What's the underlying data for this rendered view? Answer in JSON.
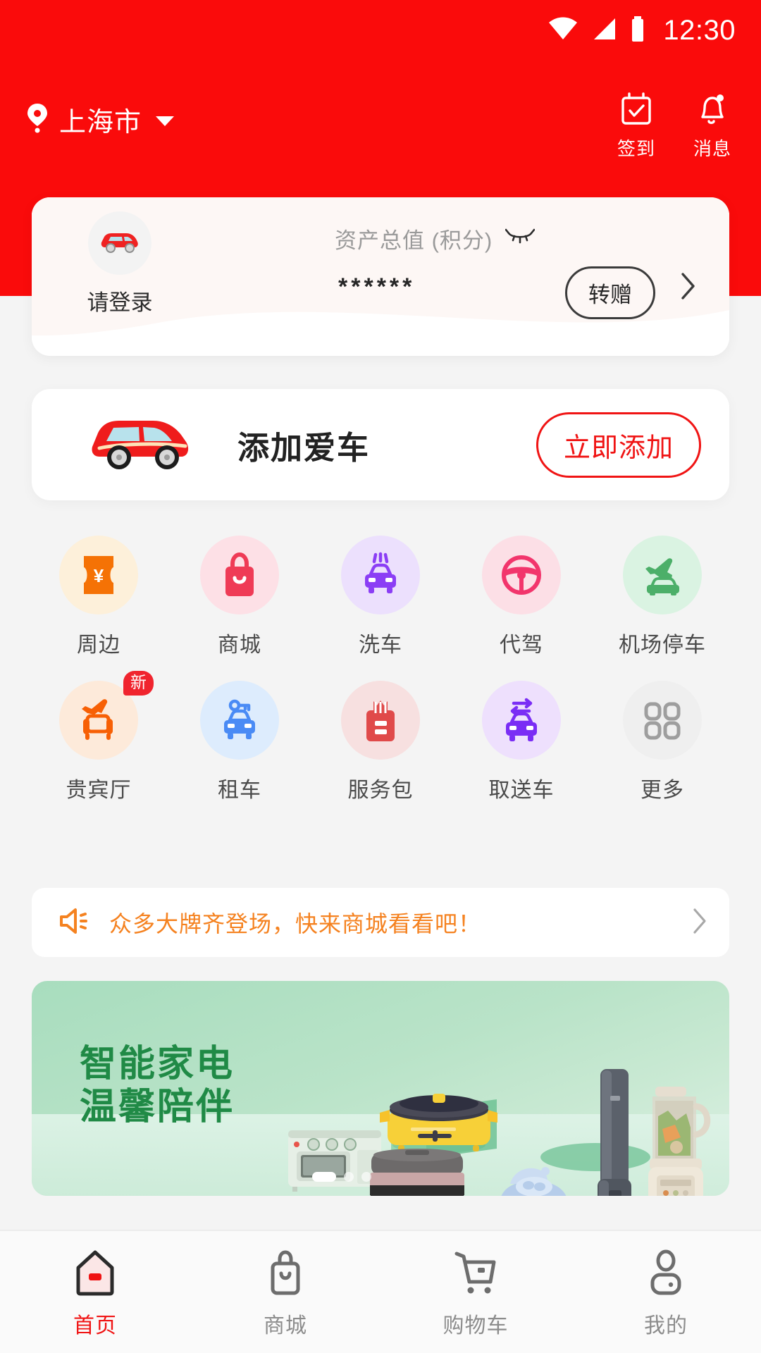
{
  "theme": {
    "brand_red": "#fa0b0b",
    "accent_orange": "#f58220",
    "banner_green": "#208a46",
    "muted_gray": "#9a9a9a"
  },
  "status_bar": {
    "time": "12:30",
    "icons": [
      "wifi-icon",
      "signal-icon",
      "battery-icon"
    ]
  },
  "header": {
    "location_icon": "location-pin-icon",
    "city": "上海市",
    "dropdown_icon": "chevron-down-icon",
    "actions": [
      {
        "icon": "checkin-calendar-icon",
        "label": "签到"
      },
      {
        "icon": "bell-icon",
        "label": "消息"
      }
    ]
  },
  "asset_card": {
    "avatar_icon": "car-avatar-icon",
    "login_label": "请登录",
    "title": "资产总值 (积分)",
    "eye_icon": "eye-closed-icon",
    "value": "******",
    "transfer_label": "转赠",
    "chevron_icon": "chevron-right-icon"
  },
  "car_card": {
    "car_icon": "red-car-icon",
    "title": "添加爱车",
    "button_label": "立即添加"
  },
  "grid": {
    "items": [
      {
        "label": "周边",
        "icon": "coupon-yuan-icon",
        "bg": "#fdf0da",
        "fg": "#f57205",
        "badge": null
      },
      {
        "label": "商城",
        "icon": "shopping-bag-icon",
        "bg": "#fde0e6",
        "fg": "#ef3b56",
        "badge": null
      },
      {
        "label": "洗车",
        "icon": "car-wash-icon",
        "bg": "#ece0fd",
        "fg": "#8b3ef5",
        "badge": null
      },
      {
        "label": "代驾",
        "icon": "steering-wheel-icon",
        "bg": "#fcdfe6",
        "fg": "#f2356c",
        "badge": null
      },
      {
        "label": "机场停车",
        "icon": "airport-parking-icon",
        "bg": "#daf3e2",
        "fg": "#4caf69",
        "badge": null
      },
      {
        "label": "贵宾厅",
        "icon": "vip-lounge-icon",
        "bg": "#fdeada",
        "fg": "#f76005",
        "badge": "新"
      },
      {
        "label": "租车",
        "icon": "car-rental-key-icon",
        "bg": "#ddecfd",
        "fg": "#4a8bf5",
        "badge": null
      },
      {
        "label": "服务包",
        "icon": "service-package-icon",
        "bg": "#f7e0e0",
        "fg": "#e04a4a",
        "badge": null
      },
      {
        "label": "取送车",
        "icon": "pickup-delivery-icon",
        "bg": "#eee0fd",
        "fg": "#7a2df5",
        "badge": null
      },
      {
        "label": "更多",
        "icon": "grid-more-icon",
        "bg": "#efefef",
        "fg": "#9e9e9e",
        "badge": null
      }
    ]
  },
  "announcement": {
    "icon": "megaphone-icon",
    "text": "众多大牌齐登场，快来商城看看吧！",
    "chevron_icon": "chevron-right-icon"
  },
  "banner": {
    "title_line1": "智能家电",
    "title_line2": "温馨陪伴",
    "dots_total": 3,
    "dots_active_index": 0
  },
  "bottom_nav": {
    "items": [
      {
        "label": "首页",
        "icon": "home-icon",
        "active": true
      },
      {
        "label": "商城",
        "icon": "store-bag-icon",
        "active": false
      },
      {
        "label": "购物车",
        "icon": "cart-icon",
        "active": false
      },
      {
        "label": "我的",
        "icon": "user-icon",
        "active": false
      }
    ]
  }
}
